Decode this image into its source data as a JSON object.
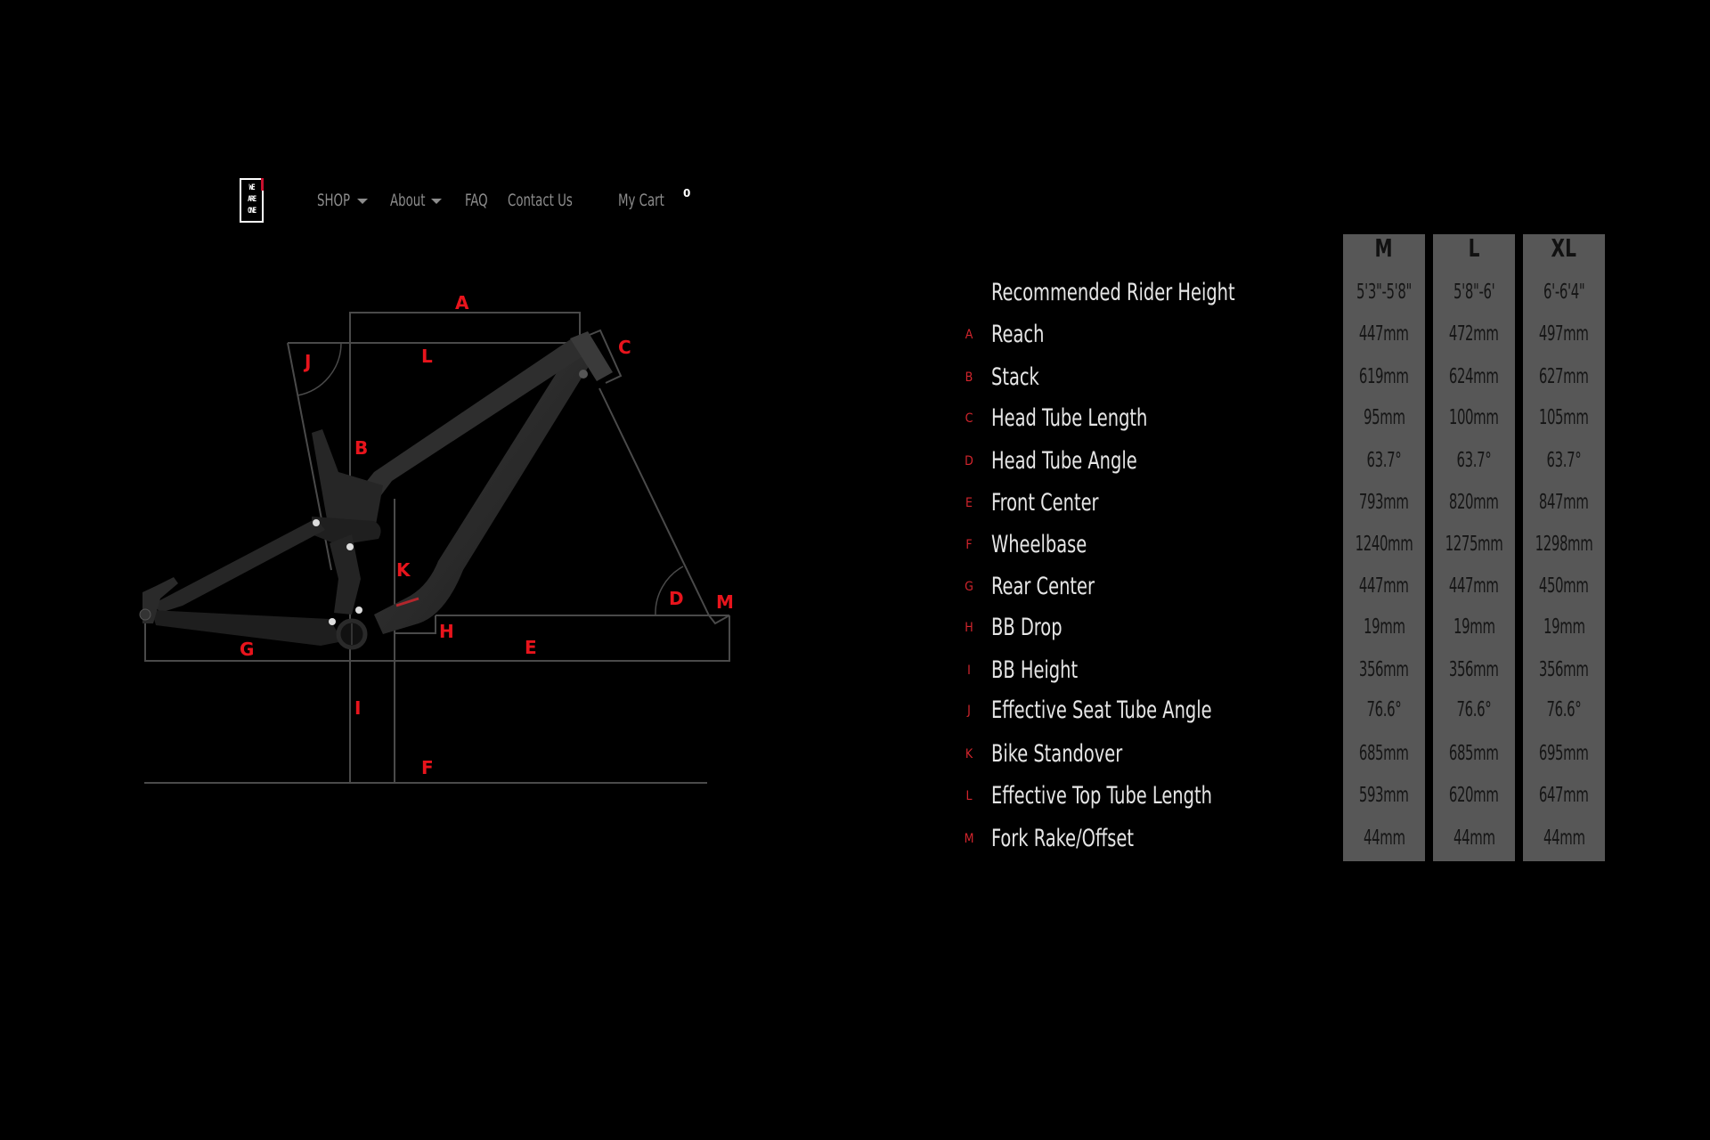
{
  "nav": {
    "logo_lines": [
      "WE",
      "ARE",
      "ONE"
    ],
    "items": [
      {
        "label": "SHOP",
        "has_dropdown": true
      },
      {
        "label": "About",
        "has_dropdown": true
      },
      {
        "label": "FAQ",
        "has_dropdown": false
      },
      {
        "label": "Contact Us",
        "has_dropdown": false
      }
    ],
    "cart_label": "My Cart",
    "cart_count": "0"
  },
  "diagram": {
    "labels": [
      "A",
      "B",
      "C",
      "D",
      "E",
      "F",
      "G",
      "H",
      "I",
      "J",
      "K",
      "L",
      "M"
    ],
    "label_color": "#e8141c",
    "line_color": "#4a4a4a"
  },
  "geometry": {
    "sizes": [
      "M",
      "L",
      "XL"
    ],
    "rows": [
      {
        "letter": "",
        "label": "Recommended Rider Height",
        "values": [
          "5'3\"-5'8\"",
          "5'8\"-6'",
          "6'-6'4\""
        ]
      },
      {
        "letter": "A",
        "label": "Reach",
        "values": [
          "447mm",
          "472mm",
          "497mm"
        ]
      },
      {
        "letter": "B",
        "label": "Stack",
        "values": [
          "619mm",
          "624mm",
          "627mm"
        ]
      },
      {
        "letter": "C",
        "label": "Head Tube Length",
        "values": [
          "95mm",
          "100mm",
          "105mm"
        ]
      },
      {
        "letter": "D",
        "label": "Head Tube Angle",
        "values": [
          "63.7°",
          "63.7°",
          "63.7°"
        ]
      },
      {
        "letter": "E",
        "label": "Front Center",
        "values": [
          "793mm",
          "820mm",
          "847mm"
        ]
      },
      {
        "letter": "F",
        "label": "Wheelbase",
        "values": [
          "1240mm",
          "1275mm",
          "1298mm"
        ]
      },
      {
        "letter": "G",
        "label": "Rear Center",
        "values": [
          "447mm",
          "447mm",
          "450mm"
        ]
      },
      {
        "letter": "H",
        "label": "BB Drop",
        "values": [
          "19mm",
          "19mm",
          "19mm"
        ]
      },
      {
        "letter": "I",
        "label": "BB Height",
        "values": [
          "356mm",
          "356mm",
          "356mm"
        ]
      },
      {
        "letter": "J",
        "label": "Effective Seat Tube Angle",
        "values": [
          "76.6°",
          "76.6°",
          "76.6°"
        ]
      },
      {
        "letter": "K",
        "label": "Bike Standover",
        "values": [
          "685mm",
          "685mm",
          "695mm"
        ]
      },
      {
        "letter": "L",
        "label": "Effective Top Tube Length",
        "values": [
          "593mm",
          "620mm",
          "647mm"
        ]
      },
      {
        "letter": "M",
        "label": "Fork Rake/Offset",
        "values": [
          "44mm",
          "44mm",
          "44mm"
        ]
      }
    ],
    "column_color": "#575757",
    "letter_color": "#d4252d"
  }
}
